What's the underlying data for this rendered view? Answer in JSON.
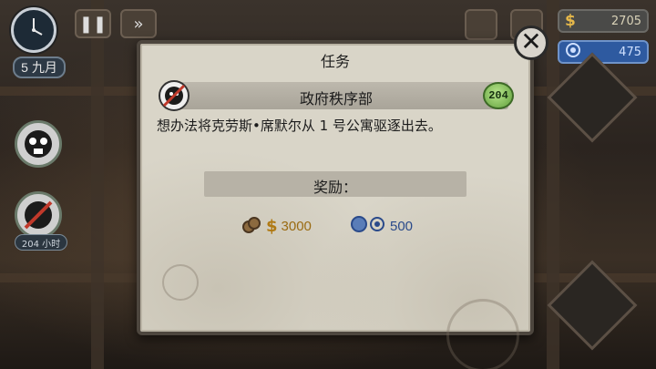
{
  "hud": {
    "date": "5 九月",
    "pause_icon": "pause-icon",
    "fast_forward_icon": "fast-forward-icon",
    "money": "2705",
    "money_symbol": "$",
    "tokens": "475",
    "small_badge": "204 小时"
  },
  "dialog": {
    "title": "任务",
    "close_icon": "close-icon",
    "mission": {
      "name": "政府秩序部",
      "score": "204",
      "description": "想办法将克劳斯•席默尔从 1 号公寓驱逐出去。"
    },
    "reward_label": "奖励：",
    "reward_money_symbol": "$",
    "reward_money": "3000",
    "reward_tokens": "500"
  },
  "colors": {
    "dialog_bg": "#d9d5c8",
    "money_gold": "#b07a14",
    "token_blue": "#2a4a8a",
    "score_green": "#5f9e3a"
  }
}
